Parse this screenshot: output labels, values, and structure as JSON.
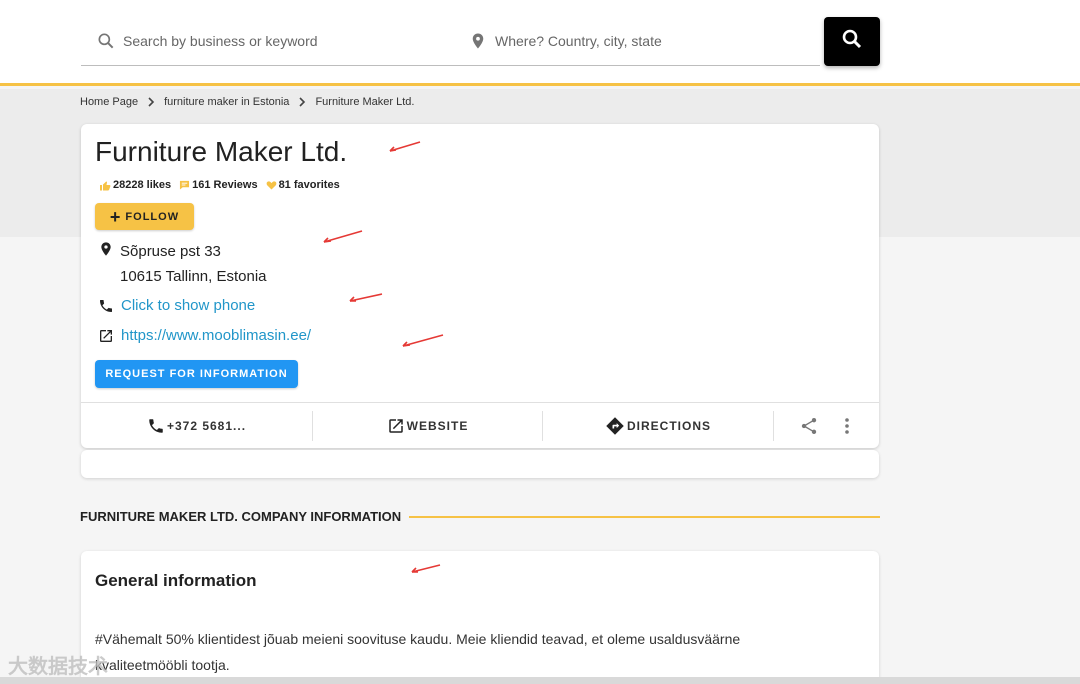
{
  "search": {
    "keyword_placeholder": "Search by business or keyword",
    "location_placeholder": "Where? Country, city, state"
  },
  "breadcrumb": {
    "items": [
      "Home Page",
      "furniture maker in Estonia",
      "Furniture Maker Ltd."
    ]
  },
  "business": {
    "name": "Furniture Maker Ltd.",
    "likes": "28228 likes",
    "reviews": "161 Reviews",
    "favorites": "81 favorites",
    "follow_label": "FOLLOW",
    "address_line1": "Sõpruse pst 33",
    "address_line2": "10615 Tallinn, Estonia",
    "phone_link": "Click to show phone",
    "website_url": "https://www.mooblimasin.ee/",
    "request_label": "REQUEST FOR INFORMATION"
  },
  "actions": {
    "phone": "+372 5681...",
    "website": "WEBSITE",
    "directions": "DIRECTIONS"
  },
  "section": {
    "heading": "FURNITURE MAKER LTD. COMPANY INFORMATION"
  },
  "general": {
    "title": "General information",
    "text": "#Vähemalt 50% klientidest jõuab meieni soovituse kaudu. Meie kliendid teavad, et oleme usaldusväärne kvaliteetmööbli tootja."
  },
  "watermark": "大数据技术",
  "colors": {
    "accent_yellow": "#f6c245",
    "button_blue": "#2196f3",
    "link_blue": "#2196c9",
    "annotation_red": "#e53935"
  }
}
